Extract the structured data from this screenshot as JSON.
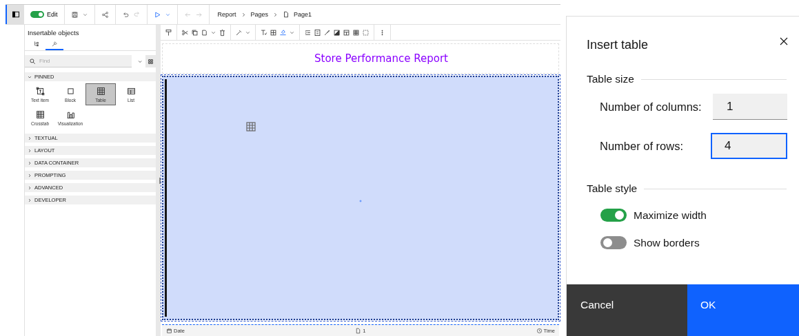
{
  "toolbar": {
    "edit_toggle": {
      "label": "Edit",
      "on": true
    },
    "breadcrumb": [
      {
        "label": "Report"
      },
      {
        "label": "Pages"
      },
      {
        "label": "Page1"
      }
    ]
  },
  "panel": {
    "title": "Insertable objects",
    "tabs": [
      {
        "selected": false
      },
      {
        "selected": true
      }
    ],
    "search": {
      "placeholder": "Find"
    },
    "sections": [
      {
        "label": "PINNED",
        "expanded": true,
        "items": [
          {
            "label": "Text item",
            "selected": false
          },
          {
            "label": "Block",
            "selected": false
          },
          {
            "label": "Table",
            "selected": true
          },
          {
            "label": "List",
            "selected": false
          },
          {
            "label": "Crosstab",
            "selected": false
          },
          {
            "label": "Visualization",
            "selected": false
          }
        ]
      },
      {
        "label": "TEXTUAL",
        "expanded": false
      },
      {
        "label": "LAYOUT",
        "expanded": false
      },
      {
        "label": "DATA CONTAINER",
        "expanded": false
      },
      {
        "label": "PROMPTING",
        "expanded": false
      },
      {
        "label": "ADVANCED",
        "expanded": false
      },
      {
        "label": "DEVELOPER",
        "expanded": false
      }
    ]
  },
  "canvas": {
    "title": "Store Performance Report",
    "footer": {
      "left": "Date",
      "center": "1",
      "right": "Time"
    }
  },
  "dialog": {
    "title": "Insert table",
    "size_section": {
      "heading": "Table size",
      "fields": [
        {
          "label": "Number of columns:",
          "value": "1",
          "focused": false
        },
        {
          "label": "Number of rows:",
          "value": "4",
          "focused": true
        }
      ]
    },
    "style_section": {
      "heading": "Table style",
      "toggles": [
        {
          "label": "Maximize width",
          "on": true
        },
        {
          "label": "Show borders",
          "on": false
        }
      ]
    },
    "buttons": [
      {
        "label": "Cancel",
        "kind": "secondary"
      },
      {
        "label": "OK",
        "kind": "primary"
      }
    ]
  }
}
